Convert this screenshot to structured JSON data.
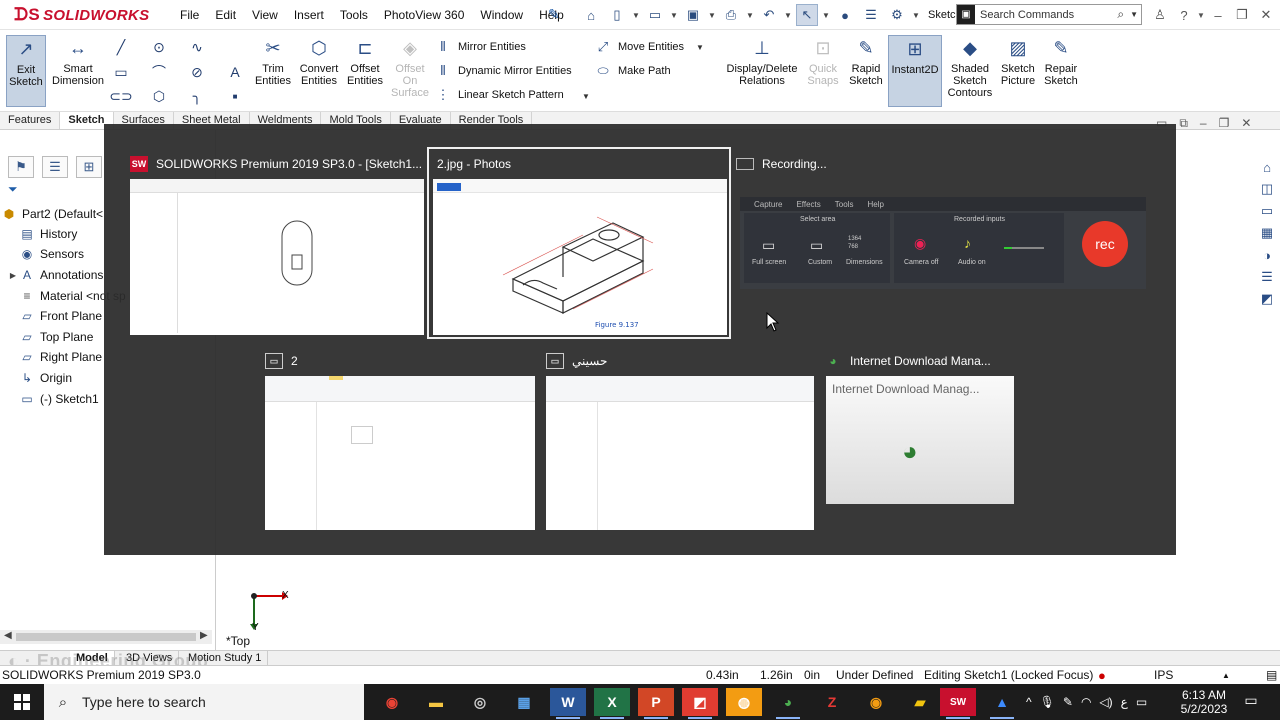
{
  "app": {
    "brand": "SOLIDWORKS",
    "menus": [
      "File",
      "Edit",
      "View",
      "Insert",
      "Tools",
      "PhotoView 360",
      "Window",
      "Help"
    ],
    "sketch_label": "Sketc...",
    "search_placeholder": "Search Commands"
  },
  "command_manager": {
    "exit_sketch": "Exit Sketch",
    "smart_dimension": "Smart Dimension",
    "trim_entities": "Trim Entities",
    "convert_entities": "Convert Entities",
    "offset_entities": "Offset Entities",
    "offset_on_surface": "Offset On Surface",
    "mirror_entities": "Mirror Entities",
    "dynamic_mirror": "Dynamic Mirror Entities",
    "linear_pattern": "Linear Sketch Pattern",
    "move_entities": "Move Entities",
    "make_path": "Make Path",
    "display_delete_relations": "Display/Delete Relations",
    "quick_snaps": "Quick Snaps",
    "rapid_sketch": "Rapid Sketch",
    "instant2d": "Instant2D",
    "shaded_contours": "Shaded Sketch Contours",
    "sketch_picture": "Sketch Picture",
    "repair_sketch": "Repair Sketch"
  },
  "command_tabs": [
    "Features",
    "Sketch",
    "Surfaces",
    "Sheet Metal",
    "Weldments",
    "Mold Tools",
    "Evaluate",
    "Render Tools"
  ],
  "feature_tree": {
    "root": "Part2 (Default<",
    "items": [
      "History",
      "Sensors",
      "Annotations",
      "Material <not sp",
      "Front Plane",
      "Top Plane",
      "Right Plane",
      "Origin",
      "(-) Sketch1"
    ]
  },
  "graphics": {
    "view_label": "*Top",
    "triad_x": "X",
    "triad_y": "Y"
  },
  "model_tabs": [
    "Model",
    "3D Views",
    "Motion Study 1"
  ],
  "watermark": "Engineering Group",
  "status": {
    "app_version": "SOLIDWORKS Premium 2019 SP3.0",
    "x": "0.43in",
    "y": "1.26in",
    "z": "0in",
    "definition": "Under Defined",
    "editing": "Editing Sketch1 (Locked Focus)",
    "units": "IPS"
  },
  "switcher": {
    "windows": [
      {
        "title": "SOLIDWORKS Premium 2019 SP3.0 - [Sketch1...",
        "app": "solidworks",
        "selected": false
      },
      {
        "title": "2.jpg - Photos",
        "app": "photos",
        "selected": true,
        "caption": "Figure 9.137"
      },
      {
        "title": "Recording...",
        "app": "recorder",
        "selected": false,
        "tabs": [
          "Capture",
          "Effects",
          "Tools",
          "Help"
        ],
        "select_area": "Select area",
        "recorded_inputs": "Recorded inputs",
        "full_screen": "Full screen",
        "custom": "Custom",
        "dimensions": "Dimensions",
        "dims": "1364\n768",
        "camera_off": "Camera off",
        "audio_on": "Audio on",
        "rec": "rec"
      },
      {
        "title": "2",
        "app": "explorer",
        "selected": false
      },
      {
        "title": "حسيني",
        "app": "explorer",
        "selected": false
      },
      {
        "title": "Internet Download Mana...",
        "app": "idm",
        "selected": false,
        "body_text": "Internet Download Manag..."
      }
    ]
  },
  "taskbar": {
    "search_placeholder": "Type here to search",
    "time": "6:13 AM",
    "date": "5/2/2023",
    "lang": "ع"
  }
}
